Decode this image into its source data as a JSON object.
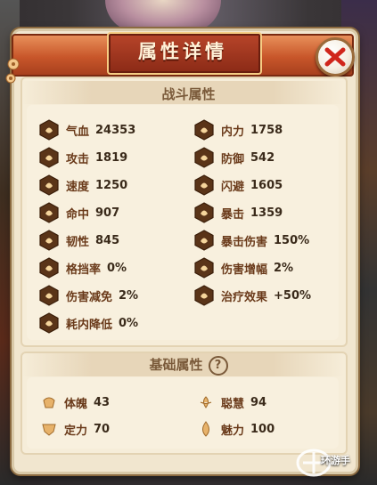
{
  "dialog": {
    "title": "属性详情",
    "close": "close"
  },
  "combat": {
    "section_title": "战斗属性",
    "left": [
      {
        "label": "气血",
        "value": "24353",
        "icon": "hp-icon"
      },
      {
        "label": "攻击",
        "value": "1819",
        "icon": "attack-icon"
      },
      {
        "label": "速度",
        "value": "1250",
        "icon": "speed-icon"
      },
      {
        "label": "命中",
        "value": "907",
        "icon": "hit-icon"
      },
      {
        "label": "韧性",
        "value": "845",
        "icon": "tenacity-icon"
      },
      {
        "label": "格挡率",
        "value": "0%",
        "icon": "block-icon"
      },
      {
        "label": "伤害减免",
        "value": "2%",
        "icon": "damage-reduction-icon"
      },
      {
        "label": "耗内降低",
        "value": "0%",
        "icon": "energy-cost-icon"
      }
    ],
    "right": [
      {
        "label": "内力",
        "value": "1758",
        "icon": "inner-power-icon"
      },
      {
        "label": "防御",
        "value": "542",
        "icon": "defense-icon"
      },
      {
        "label": "闪避",
        "value": "1605",
        "icon": "dodge-icon"
      },
      {
        "label": "暴击",
        "value": "1359",
        "icon": "crit-icon"
      },
      {
        "label": "暴击伤害",
        "value": "150%",
        "icon": "crit-damage-icon"
      },
      {
        "label": "伤害增幅",
        "value": "2%",
        "icon": "damage-boost-icon"
      },
      {
        "label": "治疗效果",
        "value": "+50%",
        "icon": "heal-icon"
      }
    ]
  },
  "basic": {
    "section_title": "基础属性",
    "help": "?",
    "left": [
      {
        "label": "体魄",
        "value": "43",
        "icon": "physique-icon"
      },
      {
        "label": "定力",
        "value": "70",
        "icon": "composure-icon"
      }
    ],
    "right": [
      {
        "label": "聪慧",
        "value": "94",
        "icon": "wisdom-icon"
      },
      {
        "label": "魅力",
        "value": "100",
        "icon": "charm-icon"
      }
    ]
  },
  "watermark": {
    "text": "环游手"
  },
  "colors": {
    "accent": "#c8562a",
    "panel": "#f1e6cf",
    "text": "#6a3a1a"
  }
}
